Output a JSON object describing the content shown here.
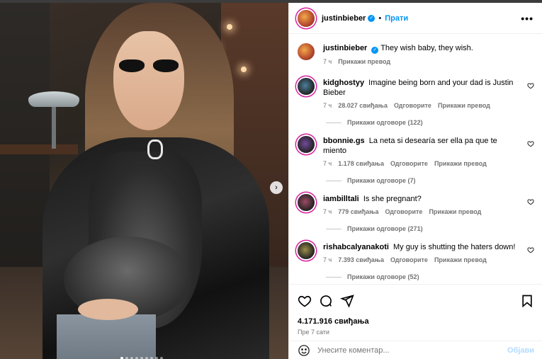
{
  "header": {
    "username": "justinbieber",
    "follow_label": "Прати",
    "more_label": "•••"
  },
  "caption": {
    "username": "justinbieber",
    "text": "They wish baby, they wish.",
    "time": "7 ч",
    "translate": "Прикажи превод"
  },
  "comments": [
    {
      "username": "kidghostyy",
      "text": "Imagine being born and your dad is Justin Bieber",
      "time": "7 ч",
      "likes": "28.027 свиђања",
      "reply": "Одговорите",
      "translate": "Прикажи превод",
      "replies": "Прикажи одговоре (122)"
    },
    {
      "username": "bbonnie.gs",
      "text": "La neta si desearía ser ella pa que te miento",
      "time": "7 ч",
      "likes": "1.178 свиђања",
      "reply": "Одговорите",
      "translate": "Прикажи превод",
      "replies": "Прикажи одговоре (7)"
    },
    {
      "username": "iambilltali",
      "text": "Is she pregnant?",
      "time": "7 ч",
      "likes": "779 свиђања",
      "reply": "Одговорите",
      "translate": "Прикажи превод",
      "replies": "Прикажи одговоре (271)"
    },
    {
      "username": "rishabcalyanakoti",
      "text": "My guy is shutting the haters down!",
      "time": "7 ч",
      "likes": "7.393 свиђања",
      "reply": "Одговорите",
      "translate": "Прикажи превод",
      "replies": "Прикажи одговоре (52)"
    }
  ],
  "post": {
    "likes": "4.171.916 свиђања",
    "time": "Пре 7 сати"
  },
  "add_comment": {
    "placeholder": "Унесите коментар...",
    "post_label": "Објави"
  },
  "carousel": {
    "slide_count": 9,
    "active_index": 0,
    "next_label": "›"
  },
  "colors": {
    "accent": "#0095f6",
    "muted": "#737373",
    "post_disabled": "#b3dbff"
  }
}
